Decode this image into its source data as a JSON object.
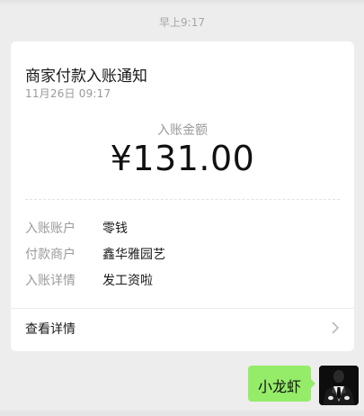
{
  "chat": {
    "timestamp": "早上9:17"
  },
  "notification": {
    "title": "商家付款入账通知",
    "date": "11月26日  09:17",
    "amount_label": "入账金额",
    "amount": "¥131.00",
    "rows": [
      {
        "label": "入账账户",
        "value": "零钱"
      },
      {
        "label": "付款商户",
        "value": "鑫华雅园艺"
      },
      {
        "label": "入账详情",
        "value": "发工资啦"
      }
    ],
    "details_label": "查看详情",
    "icons": {
      "details_chevron": "chevron-right-icon"
    }
  },
  "message": {
    "text": "小龙虾",
    "bubble_color": "#95ec69",
    "avatar_icon": "suit-figure-avatar"
  },
  "colors": {
    "background": "#ededed",
    "card": "#ffffff",
    "muted_text": "#9a9a9a"
  }
}
